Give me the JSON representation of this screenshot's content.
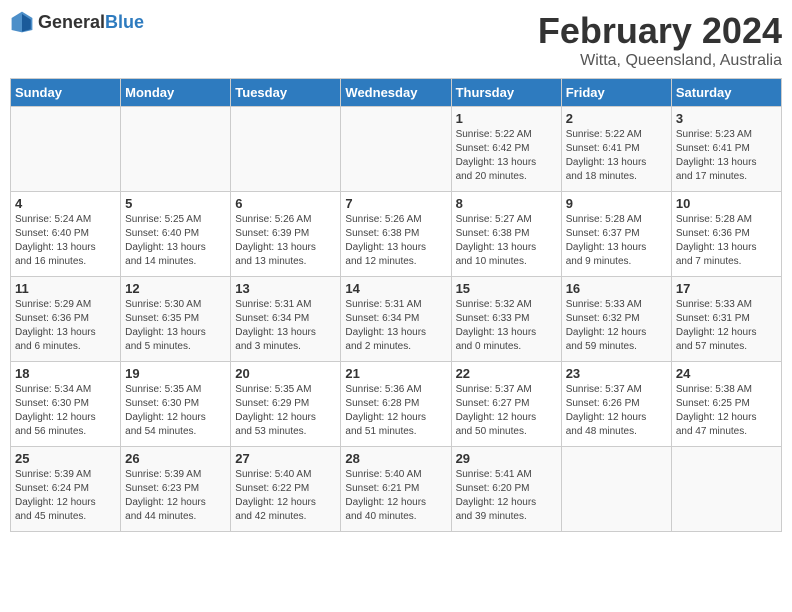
{
  "header": {
    "logo_general": "General",
    "logo_blue": "Blue",
    "main_title": "February 2024",
    "sub_title": "Witta, Queensland, Australia"
  },
  "calendar": {
    "days_of_week": [
      "Sunday",
      "Monday",
      "Tuesday",
      "Wednesday",
      "Thursday",
      "Friday",
      "Saturday"
    ],
    "weeks": [
      [
        {
          "day": "",
          "info": ""
        },
        {
          "day": "",
          "info": ""
        },
        {
          "day": "",
          "info": ""
        },
        {
          "day": "",
          "info": ""
        },
        {
          "day": "1",
          "info": "Sunrise: 5:22 AM\nSunset: 6:42 PM\nDaylight: 13 hours\nand 20 minutes."
        },
        {
          "day": "2",
          "info": "Sunrise: 5:22 AM\nSunset: 6:41 PM\nDaylight: 13 hours\nand 18 minutes."
        },
        {
          "day": "3",
          "info": "Sunrise: 5:23 AM\nSunset: 6:41 PM\nDaylight: 13 hours\nand 17 minutes."
        }
      ],
      [
        {
          "day": "4",
          "info": "Sunrise: 5:24 AM\nSunset: 6:40 PM\nDaylight: 13 hours\nand 16 minutes."
        },
        {
          "day": "5",
          "info": "Sunrise: 5:25 AM\nSunset: 6:40 PM\nDaylight: 13 hours\nand 14 minutes."
        },
        {
          "day": "6",
          "info": "Sunrise: 5:26 AM\nSunset: 6:39 PM\nDaylight: 13 hours\nand 13 minutes."
        },
        {
          "day": "7",
          "info": "Sunrise: 5:26 AM\nSunset: 6:38 PM\nDaylight: 13 hours\nand 12 minutes."
        },
        {
          "day": "8",
          "info": "Sunrise: 5:27 AM\nSunset: 6:38 PM\nDaylight: 13 hours\nand 10 minutes."
        },
        {
          "day": "9",
          "info": "Sunrise: 5:28 AM\nSunset: 6:37 PM\nDaylight: 13 hours\nand 9 minutes."
        },
        {
          "day": "10",
          "info": "Sunrise: 5:28 AM\nSunset: 6:36 PM\nDaylight: 13 hours\nand 7 minutes."
        }
      ],
      [
        {
          "day": "11",
          "info": "Sunrise: 5:29 AM\nSunset: 6:36 PM\nDaylight: 13 hours\nand 6 minutes."
        },
        {
          "day": "12",
          "info": "Sunrise: 5:30 AM\nSunset: 6:35 PM\nDaylight: 13 hours\nand 5 minutes."
        },
        {
          "day": "13",
          "info": "Sunrise: 5:31 AM\nSunset: 6:34 PM\nDaylight: 13 hours\nand 3 minutes."
        },
        {
          "day": "14",
          "info": "Sunrise: 5:31 AM\nSunset: 6:34 PM\nDaylight: 13 hours\nand 2 minutes."
        },
        {
          "day": "15",
          "info": "Sunrise: 5:32 AM\nSunset: 6:33 PM\nDaylight: 13 hours\nand 0 minutes."
        },
        {
          "day": "16",
          "info": "Sunrise: 5:33 AM\nSunset: 6:32 PM\nDaylight: 12 hours\nand 59 minutes."
        },
        {
          "day": "17",
          "info": "Sunrise: 5:33 AM\nSunset: 6:31 PM\nDaylight: 12 hours\nand 57 minutes."
        }
      ],
      [
        {
          "day": "18",
          "info": "Sunrise: 5:34 AM\nSunset: 6:30 PM\nDaylight: 12 hours\nand 56 minutes."
        },
        {
          "day": "19",
          "info": "Sunrise: 5:35 AM\nSunset: 6:30 PM\nDaylight: 12 hours\nand 54 minutes."
        },
        {
          "day": "20",
          "info": "Sunrise: 5:35 AM\nSunset: 6:29 PM\nDaylight: 12 hours\nand 53 minutes."
        },
        {
          "day": "21",
          "info": "Sunrise: 5:36 AM\nSunset: 6:28 PM\nDaylight: 12 hours\nand 51 minutes."
        },
        {
          "day": "22",
          "info": "Sunrise: 5:37 AM\nSunset: 6:27 PM\nDaylight: 12 hours\nand 50 minutes."
        },
        {
          "day": "23",
          "info": "Sunrise: 5:37 AM\nSunset: 6:26 PM\nDaylight: 12 hours\nand 48 minutes."
        },
        {
          "day": "24",
          "info": "Sunrise: 5:38 AM\nSunset: 6:25 PM\nDaylight: 12 hours\nand 47 minutes."
        }
      ],
      [
        {
          "day": "25",
          "info": "Sunrise: 5:39 AM\nSunset: 6:24 PM\nDaylight: 12 hours\nand 45 minutes."
        },
        {
          "day": "26",
          "info": "Sunrise: 5:39 AM\nSunset: 6:23 PM\nDaylight: 12 hours\nand 44 minutes."
        },
        {
          "day": "27",
          "info": "Sunrise: 5:40 AM\nSunset: 6:22 PM\nDaylight: 12 hours\nand 42 minutes."
        },
        {
          "day": "28",
          "info": "Sunrise: 5:40 AM\nSunset: 6:21 PM\nDaylight: 12 hours\nand 40 minutes."
        },
        {
          "day": "29",
          "info": "Sunrise: 5:41 AM\nSunset: 6:20 PM\nDaylight: 12 hours\nand 39 minutes."
        },
        {
          "day": "",
          "info": ""
        },
        {
          "day": "",
          "info": ""
        }
      ]
    ]
  }
}
